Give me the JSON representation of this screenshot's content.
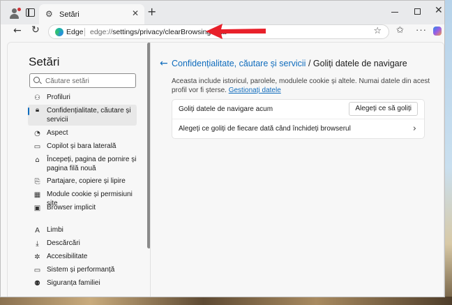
{
  "browser": {
    "tab_title": "Setări",
    "tab_close": "✕",
    "new_tab": "+",
    "brand": "Edge",
    "url_prefix": "edge://",
    "url_rest": "settings/privacy/clearBrowsingData",
    "accent": "#0f6cbd",
    "annotation_color": "#e8202a"
  },
  "sidebar": {
    "title": "Setări",
    "search_placeholder": "Căutare setări",
    "items": [
      {
        "label": "Profiluri",
        "icon": "profile-icon"
      },
      {
        "label": "Confidențialitate, căutare și servicii",
        "icon": "lock-icon",
        "active": true
      },
      {
        "label": "Aspect",
        "icon": "palette-icon"
      },
      {
        "label": "Copilot și bara laterală",
        "icon": "sidebar-icon"
      },
      {
        "label": "Începeți, pagina de pornire și pagina filă nouă",
        "icon": "home-icon"
      },
      {
        "label": "Partajare, copiere și lipire",
        "icon": "share-icon"
      },
      {
        "label": "Module cookie și permisiuni site",
        "icon": "cookie-icon"
      },
      {
        "label": "Browser implicit",
        "icon": "browser-icon"
      },
      {
        "label": "Limbi",
        "icon": "language-icon"
      },
      {
        "label": "Descărcări",
        "icon": "download-icon"
      },
      {
        "label": "Accesibilitate",
        "icon": "accessibility-icon"
      },
      {
        "label": "Sistem și performanță",
        "icon": "system-icon"
      },
      {
        "label": "Siguranța familiei",
        "icon": "family-icon"
      }
    ]
  },
  "main": {
    "breadcrumb": "Confidențialitate, căutare și servicii",
    "separator": "/",
    "title": "Goliți datele de navigare",
    "description": "Aceasta include istoricul, parolele, modulele cookie și altele. Numai datele din acest profil vor fi șterse.",
    "manage_link": "Gestionați datele",
    "row1_label": "Goliți datele de navigare acum",
    "row1_button": "Alegeți ce să goliți",
    "row2_label": "Alegeți ce goliți de fiecare dată când închideți browserul"
  }
}
